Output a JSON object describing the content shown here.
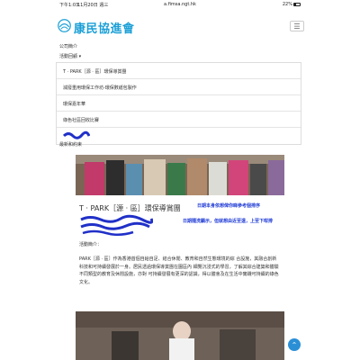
{
  "status_bar": {
    "time": "下午1:03",
    "date": "11月20日 週三",
    "url": "a.fimsa.ngt.hk",
    "battery": "22%"
  },
  "header": {
    "brand": "康民協進會",
    "menu_icon": "hamburger-icon"
  },
  "nav": {
    "about": "公司簡介",
    "activities": "活動回顧",
    "dropdown_items": [
      "T · PARK［源 · 區］環保導賞團",
      "減廢重用環保工作坊-環保數紙包製作",
      "環保嘉年華",
      "綠色社區回收比賽"
    ],
    "recent": "最新和約束"
  },
  "article": {
    "title": "T · PARK［源 · 區］環保導賞團",
    "note1": "日期本身依想俾你睇參考個排序",
    "note2": "日期隨洗顯示，但就想由近至遠，上至下咁排",
    "intro_label": "活動簡介：",
    "paragraph": "PARK［源 · 區］作為香港首個自給自足、結合休閒、教育和自然生態環境的綜 合設施，其融合創新科技和可持續發展於一身。居民透過環保導賞團在園區內 細覽沉浸式的學習，了解其綜合建築和體驗不同類型的教育及休閒設施，亦對 可持續發展有更深的認識，得以體會及在生活中實踐可持續的綠色文化。"
  },
  "colors": {
    "brand": "#1a9fd6",
    "note": "#1f3bd6",
    "totop": "#2b8fd6"
  }
}
